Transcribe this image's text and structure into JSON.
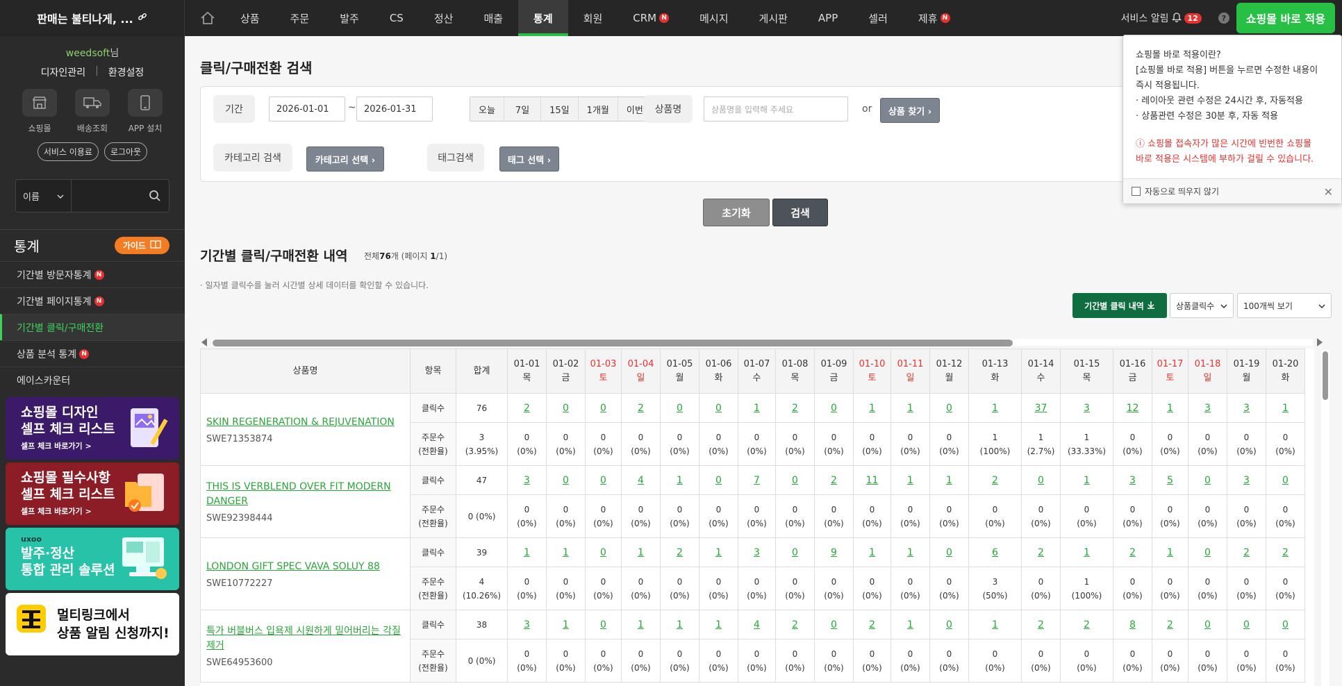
{
  "topbar": {
    "brand": "판매는 불티나게, ...",
    "nav": [
      {
        "label": "상품",
        "badge": "",
        "active": false
      },
      {
        "label": "주문",
        "badge": "",
        "active": false
      },
      {
        "label": "발주",
        "badge": "",
        "active": false
      },
      {
        "label": "CS",
        "badge": "",
        "active": false
      },
      {
        "label": "정산",
        "badge": "",
        "active": false
      },
      {
        "label": "매출",
        "badge": "",
        "active": false
      },
      {
        "label": "통계",
        "badge": "",
        "active": true
      },
      {
        "label": "회원",
        "badge": "",
        "active": false
      },
      {
        "label": "CRM",
        "badge": "N",
        "active": false
      },
      {
        "label": "메시지",
        "badge": "",
        "active": false
      },
      {
        "label": "게시판",
        "badge": "",
        "active": false
      },
      {
        "label": "APP",
        "badge": "",
        "active": false
      },
      {
        "label": "셀러",
        "badge": "",
        "active": false
      },
      {
        "label": "제휴",
        "badge": "N",
        "active": false
      }
    ],
    "service_alert": "서비스 알림",
    "alert_count": "12",
    "help": "?",
    "apply_button": "쇼핑몰 바로 적용"
  },
  "sidebar": {
    "user": "weedsoft",
    "user_suffix": "님",
    "design_link": "디자인관리",
    "divider": "|",
    "settings_link": "환경설정",
    "quick": [
      {
        "label": "쇼핑몰",
        "icon": "store-icon"
      },
      {
        "label": "배송조회",
        "icon": "truck-icon"
      },
      {
        "label": "APP 설치",
        "icon": "phone-icon"
      }
    ],
    "terms": "서비스 이용료",
    "logout": "로그아웃",
    "search_select": "이름",
    "search_value": "",
    "section_title": "통계",
    "guide": "가이드",
    "menu": [
      {
        "label": "기간별 방문자통계",
        "badge": "N",
        "active": false
      },
      {
        "label": "기간별 페이지통계",
        "badge": "N",
        "active": false
      },
      {
        "label": "기간별 클릭/구매전환",
        "badge": "",
        "active": true
      },
      {
        "label": "상품 분석 통계",
        "badge": "N",
        "active": false
      },
      {
        "label": "에이스카운터",
        "badge": "",
        "active": false
      }
    ],
    "banners": [
      {
        "line1": "쇼핑몰 디자인",
        "line2": "셀프 체크 리스트",
        "line3": "셀프 체크 바로가기 >"
      },
      {
        "line1": "쇼핑몰 필수사항",
        "line2": "셀프 체크 리스트",
        "line3": "셀프 체크 바로가기 >"
      },
      {
        "line0": "uxoo",
        "line1": "발주·정산",
        "line2": "통합 관리 솔루션"
      },
      {
        "logo": "톡.LINK",
        "line1": "멀티링크에서",
        "line2": "상품 알림 신청까지!"
      }
    ]
  },
  "search": {
    "title": "클릭/구매전환 검색",
    "period_label": "기간",
    "date_from": "2026-01-01",
    "tilde": "~",
    "date_to": "2026-01-31",
    "quick_ranges": [
      "오늘",
      "7일",
      "15일",
      "1개월",
      "이번달"
    ],
    "product_label": "상품명",
    "product_placeholder": "상품명을 입력해 주세요",
    "or": "or",
    "find_product": "상품 찾기 ›",
    "category_label": "카테고리 검색",
    "category_button": "카테고리 선택 ›",
    "tag_label": "태그검색",
    "tag_button": "태그 선택 ›",
    "reset": "초기화",
    "submit": "검색"
  },
  "list": {
    "title": "기간별 클릭/구매전환 내역",
    "total_prefix": "전체",
    "total": "76",
    "total_suffix": "개 (페이지",
    "page": "1",
    "page_suffix": "/1)",
    "note": "· 일자별 클릭수를 눌러 시간별 상세 데이터를 확인할 수 있습니다.",
    "export_button": "기간별 클릭 내역",
    "sort_select": "상품클릭수",
    "per_page_select": "100개씩 보기"
  },
  "table": {
    "head": {
      "name": "상품명",
      "item": "항목",
      "sum": "합계"
    },
    "dates": [
      {
        "d": "01-01",
        "w": "목",
        "red": false
      },
      {
        "d": "01-02",
        "w": "금",
        "red": false
      },
      {
        "d": "01-03",
        "w": "토",
        "red": true
      },
      {
        "d": "01-04",
        "w": "일",
        "red": true
      },
      {
        "d": "01-05",
        "w": "월",
        "red": false
      },
      {
        "d": "01-06",
        "w": "화",
        "red": false
      },
      {
        "d": "01-07",
        "w": "수",
        "red": false
      },
      {
        "d": "01-08",
        "w": "목",
        "red": false
      },
      {
        "d": "01-09",
        "w": "금",
        "red": false
      },
      {
        "d": "01-10",
        "w": "토",
        "red": true
      },
      {
        "d": "01-11",
        "w": "일",
        "red": true
      },
      {
        "d": "01-12",
        "w": "월",
        "red": false
      },
      {
        "d": "01-13",
        "w": "화",
        "red": false
      },
      {
        "d": "01-14",
        "w": "수",
        "red": false
      },
      {
        "d": "01-15",
        "w": "목",
        "red": false
      },
      {
        "d": "01-16",
        "w": "금",
        "red": false
      },
      {
        "d": "01-17",
        "w": "토",
        "red": true
      },
      {
        "d": "01-18",
        "w": "일",
        "red": true
      },
      {
        "d": "01-19",
        "w": "월",
        "red": false
      },
      {
        "d": "01-20",
        "w": "화",
        "red": false
      }
    ],
    "click_label": "클릭수",
    "order_label_1": "주문수",
    "order_label_2": "(전환율)",
    "rows": [
      {
        "name": "SKIN REGENERATION & REJUVENATION",
        "code": "SWE71353874",
        "click_total": "76",
        "order_total_1": "3",
        "order_total_2": "(3.95%)",
        "clicks": [
          "2",
          "0",
          "0",
          "2",
          "0",
          "0",
          "1",
          "2",
          "0",
          "1",
          "1",
          "0",
          "1",
          "37",
          "3",
          "12",
          "1",
          "3",
          "3",
          "1"
        ],
        "orders": [
          [
            "0",
            "(0%)"
          ],
          [
            "0",
            "(0%)"
          ],
          [
            "0",
            "(0%)"
          ],
          [
            "0",
            "(0%)"
          ],
          [
            "0",
            "(0%)"
          ],
          [
            "0",
            "(0%)"
          ],
          [
            "0",
            "(0%)"
          ],
          [
            "0",
            "(0%)"
          ],
          [
            "0",
            "(0%)"
          ],
          [
            "0",
            "(0%)"
          ],
          [
            "0",
            "(0%)"
          ],
          [
            "0",
            "(0%)"
          ],
          [
            "1",
            "(100%)"
          ],
          [
            "1",
            "(2.7%)"
          ],
          [
            "1",
            "(33.33%)"
          ],
          [
            "0",
            "(0%)"
          ],
          [
            "0",
            "(0%)"
          ],
          [
            "0",
            "(0%)"
          ],
          [
            "0",
            "(0%)"
          ],
          [
            "0",
            "(0%)"
          ]
        ]
      },
      {
        "name": "THIS IS VERBLEND OVER FIT MODERN DANGER",
        "code": "SWE92398444",
        "click_total": "47",
        "order_total_1": "0 (0%)",
        "order_total_2": "",
        "clicks": [
          "3",
          "0",
          "0",
          "4",
          "1",
          "0",
          "7",
          "0",
          "2",
          "11",
          "1",
          "1",
          "2",
          "0",
          "1",
          "3",
          "5",
          "0",
          "3",
          "0"
        ],
        "orders": [
          [
            "0",
            "(0%)"
          ],
          [
            "0",
            "(0%)"
          ],
          [
            "0",
            "(0%)"
          ],
          [
            "0",
            "(0%)"
          ],
          [
            "0",
            "(0%)"
          ],
          [
            "0",
            "(0%)"
          ],
          [
            "0",
            "(0%)"
          ],
          [
            "0",
            "(0%)"
          ],
          [
            "0",
            "(0%)"
          ],
          [
            "0",
            "(0%)"
          ],
          [
            "0",
            "(0%)"
          ],
          [
            "0",
            "(0%)"
          ],
          [
            "0",
            "(0%)"
          ],
          [
            "0",
            "(0%)"
          ],
          [
            "0",
            "(0%)"
          ],
          [
            "0",
            "(0%)"
          ],
          [
            "0",
            "(0%)"
          ],
          [
            "0",
            "(0%)"
          ],
          [
            "0",
            "(0%)"
          ],
          [
            "0",
            "(0%)"
          ]
        ]
      },
      {
        "name": "LONDON GIFT SPEC VAVA SOLUY 88",
        "code": "SWE10772227",
        "click_total": "39",
        "order_total_1": "4",
        "order_total_2": "(10.26%)",
        "clicks": [
          "1",
          "1",
          "0",
          "1",
          "2",
          "1",
          "3",
          "0",
          "9",
          "1",
          "1",
          "0",
          "6",
          "2",
          "1",
          "2",
          "1",
          "0",
          "2",
          "2"
        ],
        "orders": [
          [
            "0",
            "(0%)"
          ],
          [
            "0",
            "(0%)"
          ],
          [
            "0",
            "(0%)"
          ],
          [
            "0",
            "(0%)"
          ],
          [
            "0",
            "(0%)"
          ],
          [
            "0",
            "(0%)"
          ],
          [
            "0",
            "(0%)"
          ],
          [
            "0",
            "(0%)"
          ],
          [
            "0",
            "(0%)"
          ],
          [
            "0",
            "(0%)"
          ],
          [
            "0",
            "(0%)"
          ],
          [
            "0",
            "(0%)"
          ],
          [
            "3",
            "(50%)"
          ],
          [
            "0",
            "(0%)"
          ],
          [
            "1",
            "(100%)"
          ],
          [
            "0",
            "(0%)"
          ],
          [
            "0",
            "(0%)"
          ],
          [
            "0",
            "(0%)"
          ],
          [
            "0",
            "(0%)"
          ],
          [
            "0",
            "(0%)"
          ]
        ]
      },
      {
        "name": "특가 버블버스 입욕제 시원하게 밀어버리는 각질제거",
        "code": "SWE64953600",
        "click_total": "38",
        "order_total_1": "0 (0%)",
        "order_total_2": "",
        "clicks": [
          "3",
          "1",
          "0",
          "1",
          "1",
          "1",
          "4",
          "2",
          "0",
          "2",
          "1",
          "0",
          "1",
          "2",
          "2",
          "8",
          "2",
          "0",
          "0",
          "0"
        ],
        "orders": [
          [
            "0",
            "(0%)"
          ],
          [
            "0",
            "(0%)"
          ],
          [
            "0",
            "(0%)"
          ],
          [
            "0",
            "(0%)"
          ],
          [
            "0",
            "(0%)"
          ],
          [
            "0",
            "(0%)"
          ],
          [
            "0",
            "(0%)"
          ],
          [
            "0",
            "(0%)"
          ],
          [
            "0",
            "(0%)"
          ],
          [
            "0",
            "(0%)"
          ],
          [
            "0",
            "(0%)"
          ],
          [
            "0",
            "(0%)"
          ],
          [
            "0",
            "(0%)"
          ],
          [
            "0",
            "(0%)"
          ],
          [
            "0",
            "(0%)"
          ],
          [
            "0",
            "(0%)"
          ],
          [
            "0",
            "(0%)"
          ],
          [
            "0",
            "(0%)"
          ],
          [
            "0",
            "(0%)"
          ],
          [
            "0",
            "(0%)"
          ]
        ]
      }
    ]
  },
  "tooltip": {
    "line1": "쇼핑몰 바로 적용이란?",
    "line2": "[쇼핑몰 바로 적용] 버튼을 누르면 수정한 내용이",
    "line3": "즉시 적용됩니다.",
    "line4": "· 레이아웃 관련 수정은 24시간 후, 자동적용",
    "line5": "· 상품관련 수정은 30분 후, 자동 적용",
    "warn1": "ⓘ 쇼핑몰 접속자가 많은 시간에 빈번한 쇼핑몰",
    "warn2": "바로 적용은 시스템에 부하가 걸릴 수 있습니다.",
    "dont_show": "자동으로 띄우지 않기",
    "close": "✕"
  }
}
